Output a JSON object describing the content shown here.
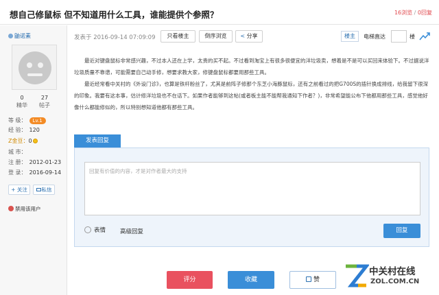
{
  "header": {
    "title": "想自己修鼠标 但不知道用什么工具，谁能提供个参照？",
    "views": "16浏览",
    "replies_sep": " / ",
    "replies": "0回复"
  },
  "sidebar": {
    "username": "鼬诺素",
    "stats": [
      {
        "value": "0",
        "label": "精华"
      },
      {
        "value": "27",
        "label": "帖子"
      }
    ],
    "level_label": "等 级：",
    "level_value": "Lv.1",
    "score_label": "经 验：",
    "score_value": "120",
    "gold_label": "Z金豆：",
    "gold_value": "0",
    "city_label": "城 市：",
    "city_value": "",
    "register_label": "注 册：",
    "register_value": "2012-01-23",
    "login_label": "登 录：",
    "login_value": "2016-09-14",
    "follow_btn": "+ 关注",
    "message_btn": "私信",
    "ban_text": "禁用该用户"
  },
  "post_meta": {
    "date": "发表于 2016-09-14 07:09:09",
    "only_op": "只看楼主",
    "reverse": "倒序浏览",
    "share": "分享",
    "louzhu": "楼主",
    "elevator": "电梯直达",
    "floor": "楼"
  },
  "post": {
    "paragraphs": [
      "最近对键盘鼠标非常感兴趣，不过本人还在上学，太贵的买不起。不过看到淘宝上有很多很便宜的洋垃圾卖，想着是不是可以买回来体验下。不过据说洋垃圾质量不靠谱，可能需要自己动手修，想要求教大家，修键盘鼠标都要用那些工具。",
      "最近经常看中关村的《外设门诊》，也算是铁杆粉丝了，尤其是前阵子修那个东芝小海豚鼠标，还有之前看过的把G700S的插针换成排线，给我留下很深的印象。我要有这本事，估计修洋垃圾也不在话下。如果作者能够到这帖(或者板主能不能帮我通知下作者？)，非常希望能公布下他都用那些工具，感觉他好像什么都能修似的，所以特别想知道他都有那些工具。"
    ]
  },
  "reply": {
    "tab": "发表回复",
    "placeholder": "回复有价值的内容，才是对作者最大的支持",
    "emoji": "表情",
    "advanced": "高级回复",
    "submit": "回复"
  },
  "actions": {
    "rate": "评分",
    "favorite": "收藏",
    "like": "赞"
  },
  "brand": {
    "name_cn": "中关村在线",
    "name_en": "ZOL.COM.CN",
    "colors": {
      "accent": "#3a8ed8",
      "rate": "#e9515f",
      "logo_green": "#6cb33e",
      "logo_blue": "#2d7dd2"
    }
  }
}
